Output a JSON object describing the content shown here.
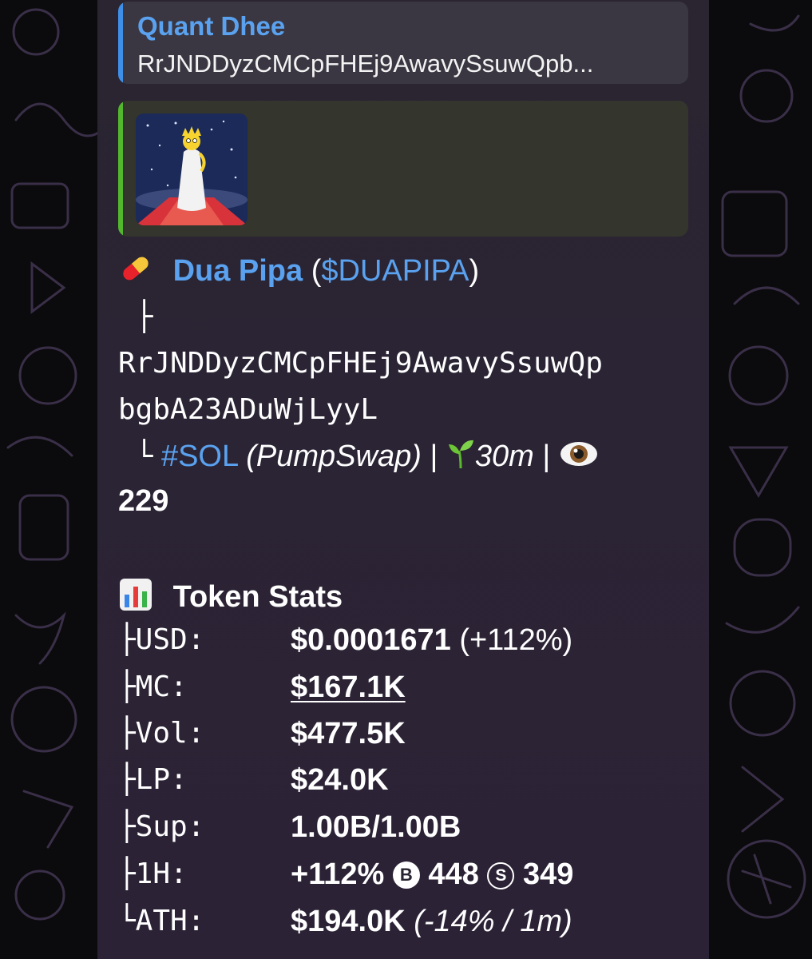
{
  "reply": {
    "name": "Quant Dhee",
    "text": "RrJNDDyzCMCpFHEj9AwavySsuwQpb..."
  },
  "preview": {
    "image_icon": "token-artwork-cartoon-singer-on-red-carpet"
  },
  "token": {
    "pill_icon": "pill-emoji",
    "name": "Dua Pipa",
    "paren_open": "(",
    "ticker": "$DUAPIPA",
    "paren_close": ")",
    "branch_char": "├",
    "address_line1": "RrJNDDyzCMCpFHEj9AwavySsuwQp",
    "address_line2": "bgbA23ADuWjLyyL",
    "end_char": "└",
    "chain": "#SOL",
    "dex": "(PumpSwap)",
    "sep1": "|",
    "sprout_icon": "seedling-emoji",
    "age": "30m",
    "sep2": "|",
    "eye_icon": "eye-emoji",
    "views": "229"
  },
  "stats": {
    "header_icon": "bar-chart-emoji",
    "title": "Token Stats",
    "usd_key": "├USD:",
    "usd_value": "$0.0001671",
    "usd_change": "(+112%)",
    "mc_key": "├MC:",
    "mc_value": "$167.1K",
    "vol_key": "├Vol:",
    "vol_value": "$477.5K",
    "lp_key": "├LP:",
    "lp_value": "$24.0K",
    "sup_key": "├Sup:",
    "sup_value": "1.00B/1.00B",
    "h1_key": "├1H:",
    "h1_change": "+112%",
    "buy_icon_letter": "B",
    "buys": "448",
    "sell_icon_letter": "S",
    "sells": "349",
    "ath_key": "└ATH:",
    "ath_value": "$194.0K",
    "ath_note": "(-14% / 1m)"
  },
  "colors": {
    "link": "#5aa2ef",
    "reply_bar": "#3f8fe8",
    "preview_bar": "#53b72e"
  }
}
